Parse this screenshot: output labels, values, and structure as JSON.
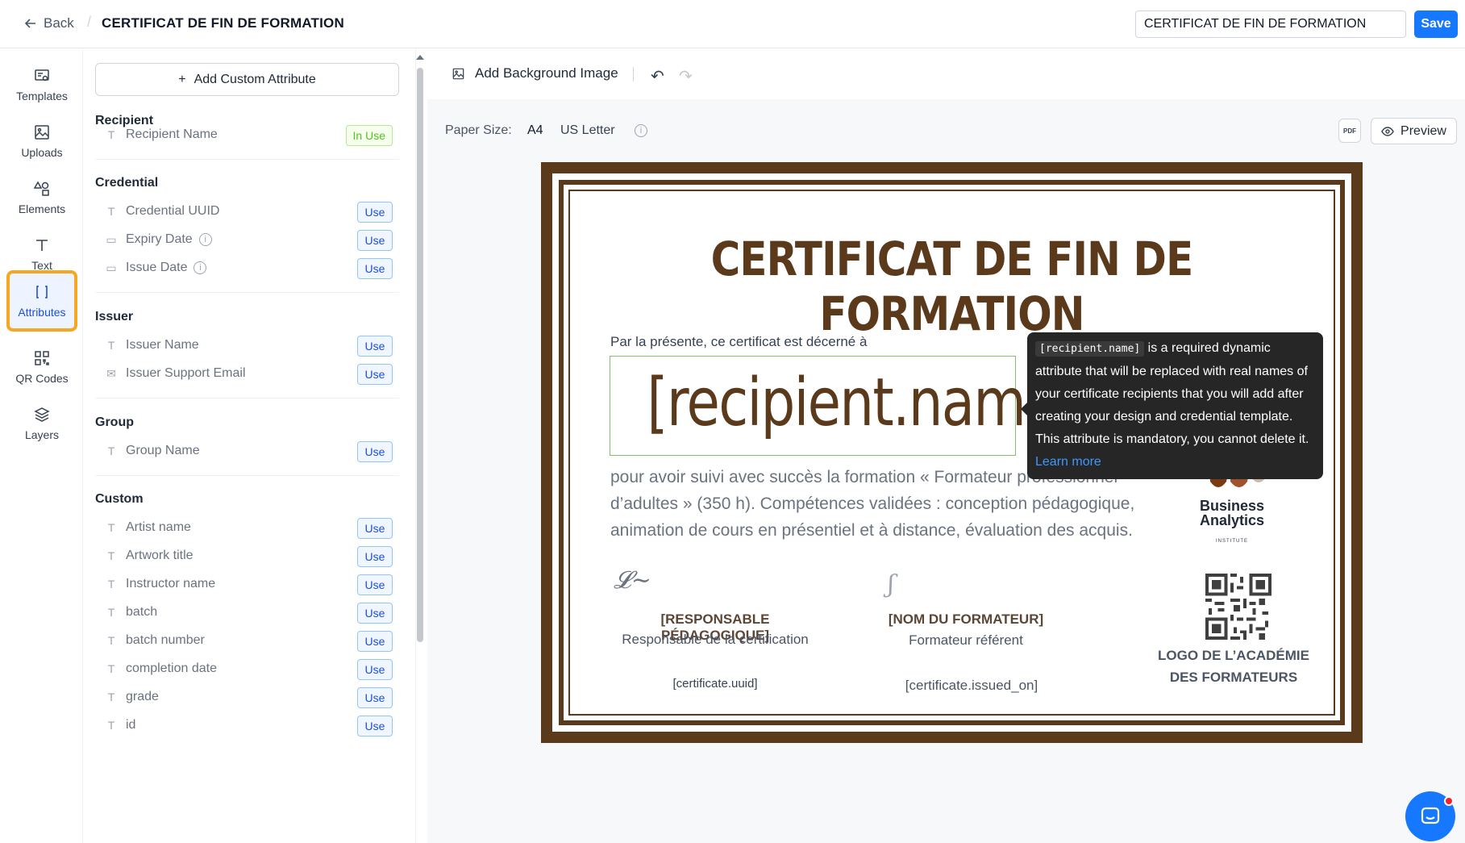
{
  "header": {
    "back_label": "Back",
    "title": "CERTIFICAT DE FIN DE FORMATION",
    "title_input_value": "CERTIFICAT DE FIN DE FORMATION",
    "save_label": "Save"
  },
  "rail": {
    "items": [
      {
        "label": "Templates",
        "icon": "templates-icon"
      },
      {
        "label": "Uploads",
        "icon": "image-icon"
      },
      {
        "label": "Elements",
        "icon": "shapes-icon"
      },
      {
        "label": "Text",
        "icon": "text-icon"
      },
      {
        "label": "Attributes",
        "icon": "brackets-icon",
        "active": true
      },
      {
        "label": "QR Codes",
        "icon": "qr-code-icon"
      },
      {
        "label": "Layers",
        "icon": "layers-icon"
      }
    ],
    "active_color": "#f5a623"
  },
  "panel": {
    "add_attribute_label": "Add Custom Attribute",
    "sections": {
      "recipient": {
        "title": "Recipient",
        "items": [
          {
            "label": "Recipient Name",
            "status": "In Use"
          }
        ]
      },
      "credential": {
        "title": "Credential",
        "items": [
          {
            "label": "Credential UUID",
            "action": "Use"
          },
          {
            "label": "Expiry Date",
            "action": "Use"
          },
          {
            "label": "Issue Date",
            "action": "Use"
          }
        ]
      },
      "issuer": {
        "title": "Issuer",
        "items": [
          {
            "label": "Issuer Name",
            "action": "Use"
          },
          {
            "label": "Issuer Support Email",
            "action": "Use"
          }
        ]
      },
      "group": {
        "title": "Group",
        "items": [
          {
            "label": "Group Name",
            "action": "Use"
          }
        ]
      },
      "custom": {
        "title": "Custom",
        "items": [
          {
            "label": "Artist name",
            "action": "Use"
          },
          {
            "label": "Artwork title",
            "action": "Use"
          },
          {
            "label": "Instructor name",
            "action": "Use"
          },
          {
            "label": "batch",
            "action": "Use"
          },
          {
            "label": "batch number",
            "action": "Use"
          },
          {
            "label": "completion date",
            "action": "Use"
          },
          {
            "label": "grade",
            "action": "Use"
          },
          {
            "label": "id",
            "action": "Use"
          }
        ]
      }
    }
  },
  "toolbar": {
    "add_background_label": "Add Background Image",
    "paper_size_label": "Paper Size:",
    "paper_a4": "A4",
    "paper_us_letter": "US Letter",
    "pdf_label": "PDF",
    "preview_label": "Preview"
  },
  "certificate": {
    "title": "CERTIFICAT DE FIN DE FORMATION",
    "awarded_text": "Par la présente, ce certificat est décerné à",
    "recipient_placeholder": "[recipient.name]",
    "body": "pour avoir suivi avec succès la formation « Formateur professionnel d’adultes » (350 h). Compétences validées : conception pédagogique, animation de cours en présentiel et à distance, évaluation des acquis.",
    "signatory1_name": "[RESPONSABLE PÉDAGOGIQUE]",
    "signatory1_role": "Responsable de la certification",
    "signatory2_name": "[NOM DU FORMATEUR]",
    "signatory2_role": "Formateur référent",
    "uuid_placeholder": "[certificate.uuid]",
    "issued_placeholder": "[certificate.issued_on]",
    "logo_line1": "Business",
    "logo_line2": "Analytics",
    "logo_sub": "INSTITUTE",
    "academy_logo_text": "LOGO DE L’ACADÉMIE DES FORMATEURS",
    "colors": {
      "brown": "#5b3a1c",
      "selection": "#86c06c"
    }
  },
  "tooltip": {
    "code": "[recipient.name]",
    "text": " is a required dynamic attribute that will be replaced with real names of your certificate recipients that you will add after creating your design and credential template. This attribute is mandatory, you cannot delete it. ",
    "link": "Learn more"
  },
  "accent_color": "#1677ff"
}
